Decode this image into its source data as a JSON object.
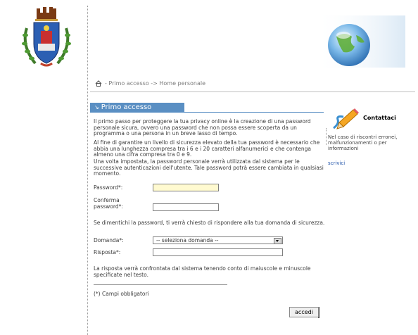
{
  "breadcrumb": {
    "text": "- Primo accesso -> Home personale"
  },
  "section": {
    "title": "Primo accesso"
  },
  "intro": {
    "p1": "Il primo passo per proteggere la tua privacy online è la creazione di una password personale sicura, ovvero una password che non possa essere scoperta da un programma o una persona in un breve lasso di tempo.",
    "p2": "Al fine di garantire un livello di sicurezza elevato della tua password è necessario che abbia una lunghezza compresa tra i 6 e i 20 caratteri alfanumerici e che contenga almeno una cifra compresa tra 0 e 9.",
    "p3": "Una volta impostata, la password personale verrà utilizzata dal sistema per le successive autenticazioni dell'utente. Tale password potrà essere cambiata in qualsiasi momento."
  },
  "form": {
    "password_label": "Password*:",
    "confirm_label_1": "Conferma",
    "confirm_label_2": "password*:",
    "question_intro": "Se dimentichi la password, ti verrà chiesto di rispondere alla tua domanda di sicurezza.",
    "question_label": "Domanda*:",
    "question_selected": "-- seleziona domanda --",
    "answer_label": "Risposta*:",
    "answer_note": "La risposta verrà confrontata dal sistema tenendo conto di maiuscole e minuscole specificate nel testo.",
    "required_note": "(*) Campi obbligatori",
    "submit_label": "accedi"
  },
  "contact": {
    "title": "Contattaci",
    "text": "Nel caso di riscontri erronei, malfunzionamenti o per informazioni",
    "link": "scrivici"
  },
  "icons": {
    "crest": "municipal-crest-icon",
    "globe": "globe-icon",
    "home": "home-icon",
    "pencil": "pencil-icon"
  },
  "colors": {
    "accent": "#5a8fc3",
    "password_field_bg": "#fffad0",
    "link": "#2255aa"
  }
}
